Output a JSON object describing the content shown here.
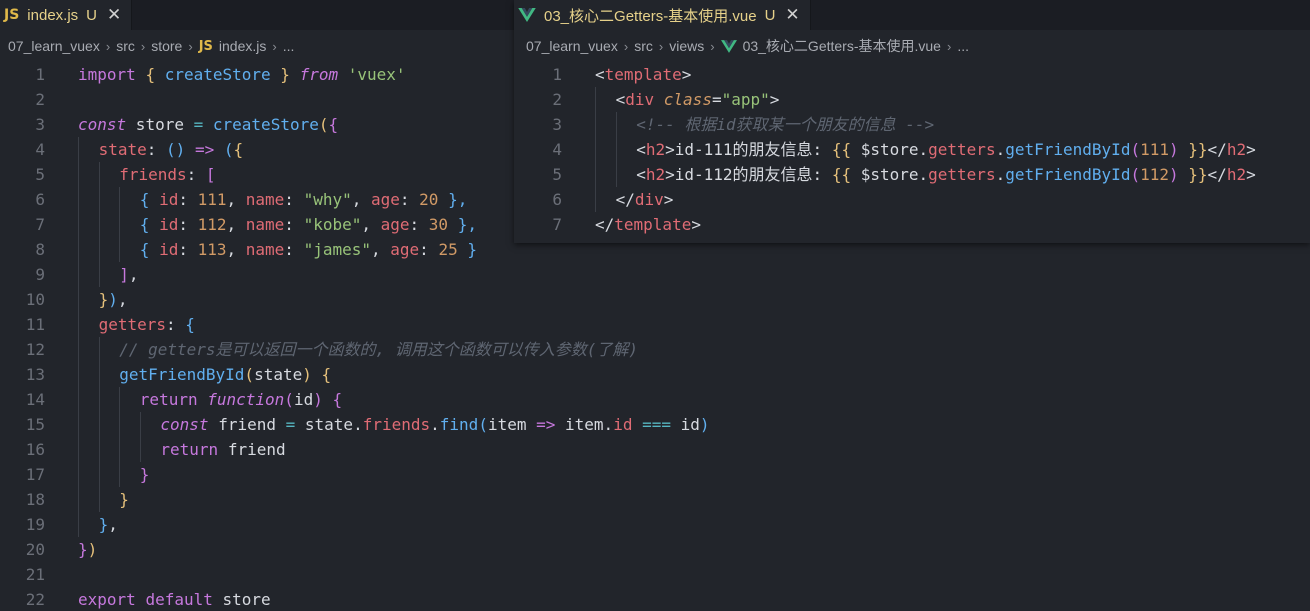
{
  "left_editor": {
    "tab": {
      "icon": "js-file-icon",
      "icon_text": "JS",
      "name": "index.js",
      "status": "U",
      "close": "✕"
    },
    "breadcrumb": {
      "items": [
        "07_learn_vuex",
        "src",
        "store",
        "index.js",
        "..."
      ],
      "icon_text": "JS",
      "separator": "›"
    },
    "lines": [
      {
        "n": "1",
        "i": 0,
        "t": [
          [
            "import ",
            "kw"
          ],
          [
            "{ ",
            "br1"
          ],
          [
            "createStore",
            "fn"
          ],
          [
            " } ",
            "br1"
          ],
          [
            "from",
            "kwi"
          ],
          [
            " ",
            "pl"
          ],
          [
            "'vuex'",
            "str"
          ]
        ]
      },
      {
        "n": "2",
        "i": 0,
        "t": []
      },
      {
        "n": "3",
        "i": 0,
        "t": [
          [
            "const",
            "kwi"
          ],
          [
            " store ",
            "pl"
          ],
          [
            "=",
            "op"
          ],
          [
            " ",
            "pl"
          ],
          [
            "createStore",
            "fn"
          ],
          [
            "(",
            "br1"
          ],
          [
            "{",
            "br2"
          ]
        ]
      },
      {
        "n": "4",
        "i": 1,
        "t": [
          [
            "state",
            "prop"
          ],
          [
            ": ",
            "pl"
          ],
          [
            "()",
            "br3"
          ],
          [
            " ",
            "pl"
          ],
          [
            "=>",
            "kw"
          ],
          [
            " ",
            "pl"
          ],
          [
            "(",
            "br3"
          ],
          [
            "{",
            "br1"
          ]
        ]
      },
      {
        "n": "5",
        "i": 2,
        "t": [
          [
            "friends",
            "prop"
          ],
          [
            ": ",
            "pl"
          ],
          [
            "[",
            "br2"
          ]
        ]
      },
      {
        "n": "6",
        "i": 3,
        "t": [
          [
            "{ ",
            "br3"
          ],
          [
            "id",
            "prop"
          ],
          [
            ": ",
            "pl"
          ],
          [
            "111",
            "num"
          ],
          [
            ", ",
            "pl"
          ],
          [
            "name",
            "prop"
          ],
          [
            ": ",
            "pl"
          ],
          [
            "\"why\"",
            "str"
          ],
          [
            ", ",
            "pl"
          ],
          [
            "age",
            "prop"
          ],
          [
            ": ",
            "pl"
          ],
          [
            "20",
            "num"
          ],
          [
            " },",
            "br3"
          ]
        ]
      },
      {
        "n": "7",
        "i": 3,
        "t": [
          [
            "{ ",
            "br3"
          ],
          [
            "id",
            "prop"
          ],
          [
            ": ",
            "pl"
          ],
          [
            "112",
            "num"
          ],
          [
            ", ",
            "pl"
          ],
          [
            "name",
            "prop"
          ],
          [
            ": ",
            "pl"
          ],
          [
            "\"kobe\"",
            "str"
          ],
          [
            ", ",
            "pl"
          ],
          [
            "age",
            "prop"
          ],
          [
            ": ",
            "pl"
          ],
          [
            "30",
            "num"
          ],
          [
            " },",
            "br3"
          ]
        ]
      },
      {
        "n": "8",
        "i": 3,
        "t": [
          [
            "{ ",
            "br3"
          ],
          [
            "id",
            "prop"
          ],
          [
            ": ",
            "pl"
          ],
          [
            "113",
            "num"
          ],
          [
            ", ",
            "pl"
          ],
          [
            "name",
            "prop"
          ],
          [
            ": ",
            "pl"
          ],
          [
            "\"james\"",
            "str"
          ],
          [
            ", ",
            "pl"
          ],
          [
            "age",
            "prop"
          ],
          [
            ": ",
            "pl"
          ],
          [
            "25",
            "num"
          ],
          [
            " }",
            "br3"
          ]
        ]
      },
      {
        "n": "9",
        "i": 2,
        "t": [
          [
            "]",
            "br2"
          ],
          [
            ",",
            "pl"
          ]
        ]
      },
      {
        "n": "10",
        "i": 1,
        "t": [
          [
            "}",
            "br1"
          ],
          [
            ")",
            "br3"
          ],
          [
            ",",
            "pl"
          ]
        ]
      },
      {
        "n": "11",
        "i": 1,
        "t": [
          [
            "getters",
            "prop"
          ],
          [
            ": ",
            "pl"
          ],
          [
            "{",
            "br3"
          ]
        ]
      },
      {
        "n": "12",
        "i": 2,
        "t": [
          [
            "// getters是可以返回一个函数的, 调用这个函数可以传入参数(了解)",
            "cm"
          ]
        ]
      },
      {
        "n": "13",
        "i": 2,
        "t": [
          [
            "getFriendById",
            "fn"
          ],
          [
            "(",
            "br1"
          ],
          [
            "state",
            "pl"
          ],
          [
            ")",
            "br1"
          ],
          [
            " ",
            "pl"
          ],
          [
            "{",
            "br1"
          ]
        ]
      },
      {
        "n": "14",
        "i": 3,
        "t": [
          [
            "return ",
            "kw"
          ],
          [
            "function",
            "kwi"
          ],
          [
            "(",
            "br2"
          ],
          [
            "id",
            "pl"
          ],
          [
            ")",
            "br2"
          ],
          [
            " ",
            "pl"
          ],
          [
            "{",
            "br2"
          ]
        ]
      },
      {
        "n": "15",
        "i": 4,
        "t": [
          [
            "const",
            "kwi"
          ],
          [
            " friend ",
            "pl"
          ],
          [
            "=",
            "op"
          ],
          [
            " state.",
            "pl"
          ],
          [
            "friends",
            "prop"
          ],
          [
            ".",
            "pl"
          ],
          [
            "find",
            "fn"
          ],
          [
            "(",
            "br3"
          ],
          [
            "item ",
            "pl"
          ],
          [
            "=>",
            "kw"
          ],
          [
            " item.",
            "pl"
          ],
          [
            "id",
            "prop"
          ],
          [
            " ",
            "pl"
          ],
          [
            "===",
            "op"
          ],
          [
            " id",
            "pl"
          ],
          [
            ")",
            "br3"
          ]
        ]
      },
      {
        "n": "16",
        "i": 4,
        "t": [
          [
            "return ",
            "kw"
          ],
          [
            "friend",
            "pl"
          ]
        ]
      },
      {
        "n": "17",
        "i": 3,
        "t": [
          [
            "}",
            "br2"
          ]
        ]
      },
      {
        "n": "18",
        "i": 2,
        "t": [
          [
            "}",
            "br1"
          ]
        ]
      },
      {
        "n": "19",
        "i": 1,
        "t": [
          [
            "}",
            "br3"
          ],
          [
            ",",
            "pl"
          ]
        ]
      },
      {
        "n": "20",
        "i": 0,
        "t": [
          [
            "}",
            "br2"
          ],
          [
            ")",
            "br1"
          ]
        ]
      },
      {
        "n": "21",
        "i": 0,
        "t": []
      },
      {
        "n": "22",
        "i": 0,
        "t": [
          [
            "export ",
            "kw"
          ],
          [
            "default ",
            "kw"
          ],
          [
            "store",
            "pl"
          ]
        ]
      }
    ]
  },
  "right_editor": {
    "tab": {
      "icon": "vue-file-icon",
      "name": "03_核心二Getters-基本使用.vue",
      "status": "U",
      "close": "✕"
    },
    "breadcrumb": {
      "items": [
        "07_learn_vuex",
        "src",
        "views",
        "03_核心二Getters-基本使用.vue",
        "..."
      ],
      "separator": "›"
    },
    "lines": [
      {
        "n": "1",
        "i": 0,
        "t": [
          [
            "<",
            "pl"
          ],
          [
            "template",
            "tag"
          ],
          [
            ">",
            "pl"
          ]
        ]
      },
      {
        "n": "2",
        "i": 1,
        "t": [
          [
            "<",
            "pl"
          ],
          [
            "div",
            "tag"
          ],
          [
            " ",
            "pl"
          ],
          [
            "class",
            "attr"
          ],
          [
            "=",
            "pl"
          ],
          [
            "\"app\"",
            "str"
          ],
          [
            ">",
            "pl"
          ]
        ]
      },
      {
        "n": "3",
        "i": 2,
        "t": [
          [
            "<!-- 根据id获取某一个朋友的信息 -->",
            "cm"
          ]
        ]
      },
      {
        "n": "4",
        "i": 2,
        "t": [
          [
            "<",
            "pl"
          ],
          [
            "h2",
            "tag"
          ],
          [
            ">",
            "pl"
          ],
          [
            "id-111的朋友信息: ",
            "pl"
          ],
          [
            "{{",
            "br1"
          ],
          [
            " $store.",
            "pl"
          ],
          [
            "getters",
            "prop"
          ],
          [
            ".",
            "pl"
          ],
          [
            "getFriendById",
            "fn"
          ],
          [
            "(",
            "br2"
          ],
          [
            "111",
            "num"
          ],
          [
            ")",
            "br2"
          ],
          [
            " ",
            "pl"
          ],
          [
            "}}",
            "br1"
          ],
          [
            "</",
            "pl"
          ],
          [
            "h2",
            "tag"
          ],
          [
            ">",
            "pl"
          ]
        ]
      },
      {
        "n": "5",
        "i": 2,
        "t": [
          [
            "<",
            "pl"
          ],
          [
            "h2",
            "tag"
          ],
          [
            ">",
            "pl"
          ],
          [
            "id-112的朋友信息: ",
            "pl"
          ],
          [
            "{{",
            "br1"
          ],
          [
            " $store.",
            "pl"
          ],
          [
            "getters",
            "prop"
          ],
          [
            ".",
            "pl"
          ],
          [
            "getFriendById",
            "fn"
          ],
          [
            "(",
            "br2"
          ],
          [
            "112",
            "num"
          ],
          [
            ")",
            "br2"
          ],
          [
            " ",
            "pl"
          ],
          [
            "}}",
            "br1"
          ],
          [
            "</",
            "pl"
          ],
          [
            "h2",
            "tag"
          ],
          [
            ">",
            "pl"
          ]
        ]
      },
      {
        "n": "6",
        "i": 1,
        "t": [
          [
            "</",
            "pl"
          ],
          [
            "div",
            "tag"
          ],
          [
            ">",
            "pl"
          ]
        ]
      },
      {
        "n": "7",
        "i": 0,
        "t": [
          [
            "</",
            "pl"
          ],
          [
            "template",
            "tag"
          ],
          [
            ">",
            "pl"
          ]
        ]
      }
    ]
  },
  "colors": {
    "editor_bg": "#22252b",
    "tabbar_bg": "#1b1d23",
    "modified": "#e6d18a",
    "js_icon": "#e0b94a",
    "vue_icon": "#41b883"
  }
}
